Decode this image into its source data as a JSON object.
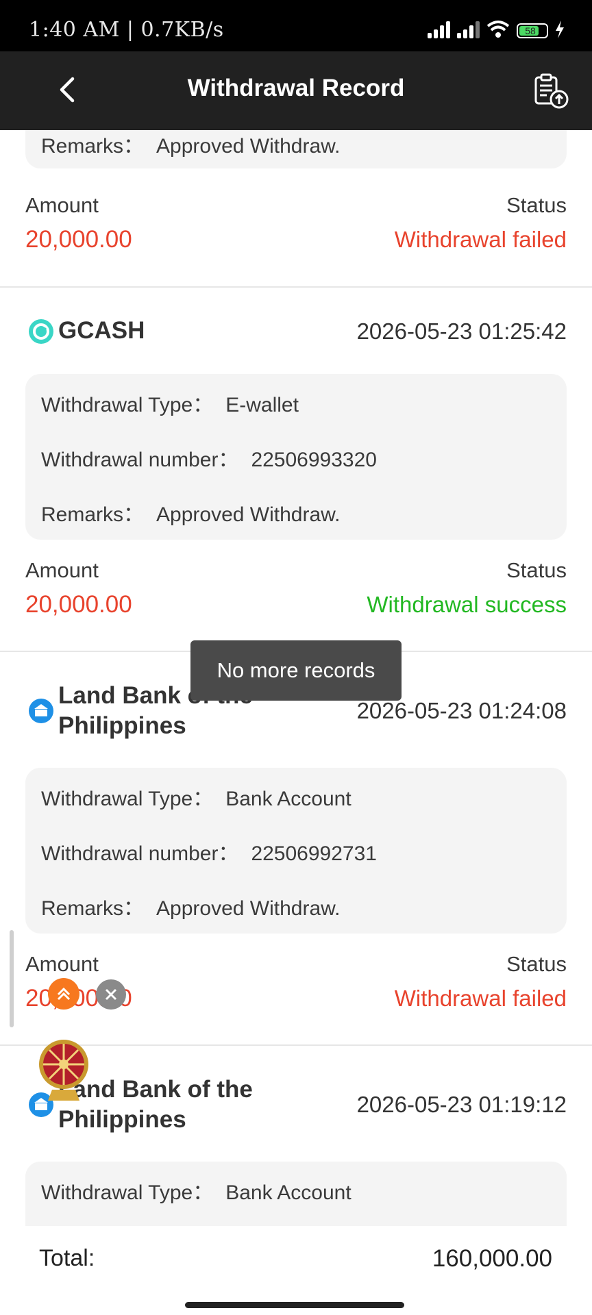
{
  "status_bar": {
    "time_text": "1:40 AM | 0.7KB/s",
    "battery_level": "58"
  },
  "header": {
    "title": "Withdrawal Record"
  },
  "labels": {
    "withdrawal_type": "Withdrawal Type：",
    "withdrawal_number": "Withdrawal number：",
    "remarks": "Remarks：",
    "amount": "Amount",
    "status": "Status"
  },
  "records": [
    {
      "remarks": "Approved Withdraw.",
      "amount": "20,000.00",
      "status": "Withdrawal failed"
    },
    {
      "bank": "GCASH",
      "datetime": "2026-05-23 01:25:42",
      "type": "E-wallet",
      "number": "22506993320",
      "remarks": "Approved Withdraw.",
      "amount": "20,000.00",
      "status": "Withdrawal success"
    },
    {
      "bank": "Land Bank of the Philippines",
      "datetime": "2026-05-23 01:24:08",
      "type": "Bank Account",
      "number": "22506992731",
      "remarks": "Approved Withdraw.",
      "amount": "20,000.00",
      "status": "Withdrawal failed"
    },
    {
      "bank": "Land Bank of the Philippines",
      "datetime": "2026-05-23 01:19:12",
      "type": "Bank Account"
    }
  ],
  "toast": "No more records",
  "footer": {
    "total_label": "Total:",
    "total_value": "160,000.00"
  },
  "colors": {
    "failed": "#e8432d",
    "success": "#22b822",
    "amount": "#e8432d",
    "header_bg": "#212121"
  }
}
